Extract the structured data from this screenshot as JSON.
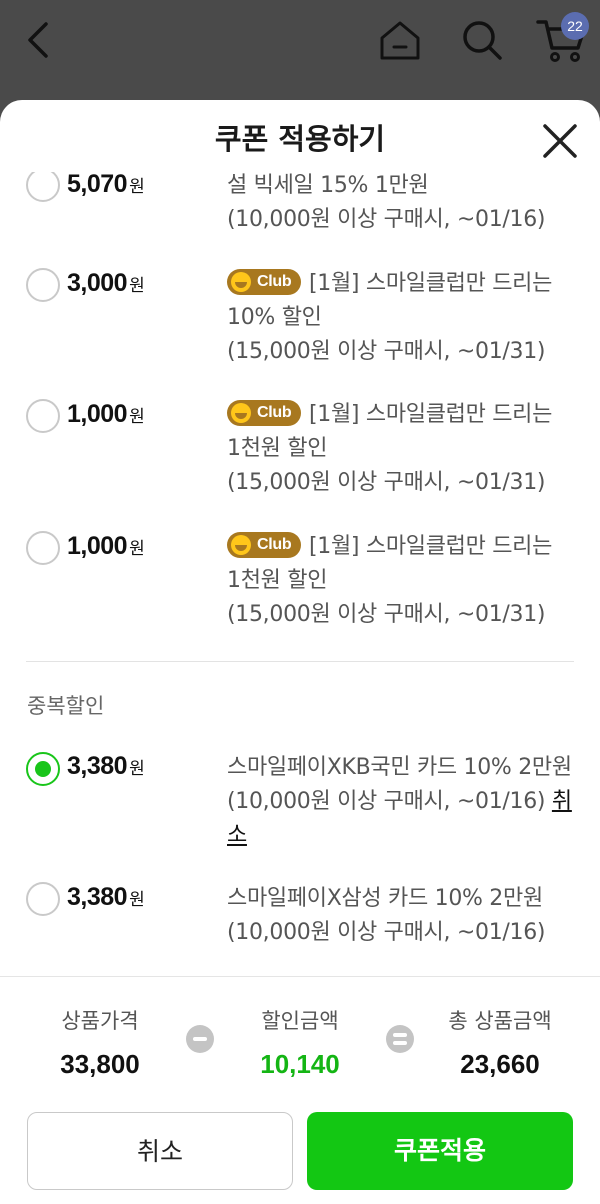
{
  "topbar": {
    "cart_count": "22",
    "icons": [
      "back-icon",
      "home-icon",
      "search-icon",
      "cart-icon"
    ]
  },
  "sheet": {
    "title": "쿠폰 적용하기"
  },
  "coupons": [
    {
      "amount": "5,070",
      "unit": "원",
      "badge": "",
      "desc_line1": "설 빅세일 15% 1만원",
      "desc_line2": "(10,000원 이상 구매시, ~01/16)",
      "selected": false
    },
    {
      "amount": "3,000",
      "unit": "원",
      "badge": "Club",
      "desc_line1": "[1월] 스마일클럽만 드리는",
      "desc_line2": "10% 할인",
      "desc_line3": "(15,000원 이상 구매시, ~01/31)",
      "selected": false
    },
    {
      "amount": "1,000",
      "unit": "원",
      "badge": "Club",
      "desc_line1": "[1월] 스마일클럽만 드리는",
      "desc_line2": "1천원 할인",
      "desc_line3": "(15,000원 이상 구매시, ~01/31)",
      "selected": false
    },
    {
      "amount": "1,000",
      "unit": "원",
      "badge": "Club",
      "desc_line1": "[1월] 스마일클럽만 드리는",
      "desc_line2": "1천원 할인",
      "desc_line3": "(15,000원 이상 구매시, ~01/31)",
      "selected": false
    }
  ],
  "duplicate_section": {
    "label": "중복할인",
    "coupons": [
      {
        "amount": "3,380",
        "unit": "원",
        "desc_line1": "스마일페이XKB국민 카드 10% 2만원",
        "desc_line2": "(10,000원 이상 구매시, ~01/16)",
        "cancel_part1": "취",
        "cancel_part2": "소",
        "selected": true
      },
      {
        "amount": "3,380",
        "unit": "원",
        "desc_line1": "스마일페이X삼성 카드 10% 2만원",
        "desc_line2": "(10,000원 이상 구매시, ~01/16)",
        "selected": false
      }
    ]
  },
  "summary": {
    "product_price_label": "상품가격",
    "product_price": "33,800",
    "discount_label": "할인금액",
    "discount": "10,140",
    "total_label": "총 상품금액",
    "total": "23,660"
  },
  "buttons": {
    "cancel": "취소",
    "apply": "쿠폰적용"
  },
  "colors": {
    "accent_green": "#13c713",
    "club_badge": "#a8781f"
  }
}
